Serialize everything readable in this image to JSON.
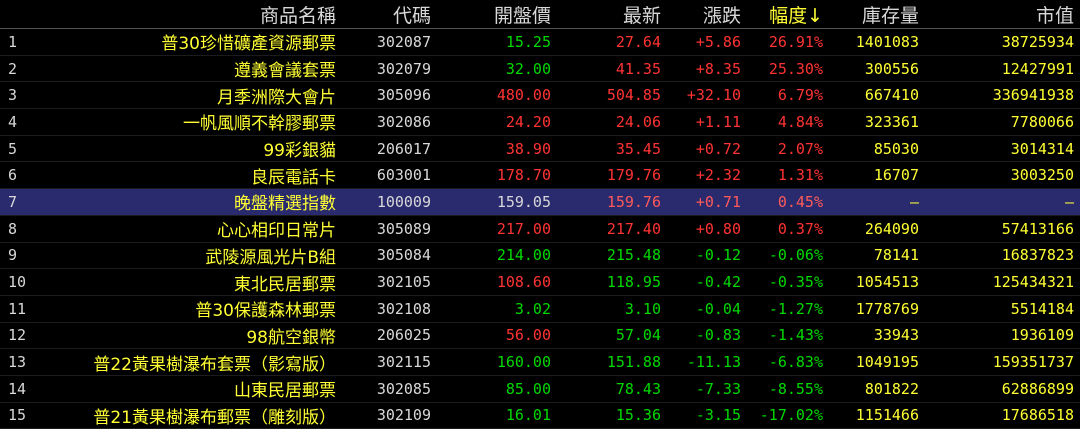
{
  "headers": {
    "name": "商品名稱",
    "code": "代碼",
    "open": "開盤價",
    "latest": "最新",
    "change": "漲跌",
    "pct": "幅度↓",
    "stock": "庫存量",
    "cap": "市值"
  },
  "rows": [
    {
      "idx": "1",
      "name": "普30珍惜礦產資源郵票",
      "code": "302087",
      "open": "15.25",
      "open_color": "green",
      "latest": "27.64",
      "latest_color": "red",
      "change": "+5.86",
      "change_color": "red",
      "pct": "26.91%",
      "pct_color": "red",
      "stock": "1401083",
      "cap": "38725934"
    },
    {
      "idx": "2",
      "name": "遵義會議套票",
      "code": "302079",
      "open": "32.00",
      "open_color": "green",
      "latest": "41.35",
      "latest_color": "red",
      "change": "+8.35",
      "change_color": "red",
      "pct": "25.30%",
      "pct_color": "red",
      "stock": "300556",
      "cap": "12427991"
    },
    {
      "idx": "3",
      "name": "月季洲際大會片",
      "code": "305096",
      "open": "480.00",
      "open_color": "red",
      "latest": "504.85",
      "latest_color": "red",
      "change": "+32.10",
      "change_color": "red",
      "pct": "6.79%",
      "pct_color": "red",
      "stock": "667410",
      "cap": "336941938"
    },
    {
      "idx": "4",
      "name": "一帆風順不幹膠郵票",
      "code": "302086",
      "open": "24.20",
      "open_color": "red",
      "latest": "24.06",
      "latest_color": "red",
      "change": "+1.11",
      "change_color": "red",
      "pct": "4.84%",
      "pct_color": "red",
      "stock": "323361",
      "cap": "7780066"
    },
    {
      "idx": "5",
      "name": "99彩銀貓",
      "code": "206017",
      "open": "38.90",
      "open_color": "red",
      "latest": "35.45",
      "latest_color": "red",
      "change": "+0.72",
      "change_color": "red",
      "pct": "2.07%",
      "pct_color": "red",
      "stock": "85030",
      "cap": "3014314"
    },
    {
      "idx": "6",
      "name": "良辰電話卡",
      "code": "603001",
      "open": "178.70",
      "open_color": "red",
      "latest": "179.76",
      "latest_color": "red",
      "change": "+2.32",
      "change_color": "red",
      "pct": "1.31%",
      "pct_color": "red",
      "stock": "16707",
      "cap": "3003250"
    },
    {
      "idx": "7",
      "name": "晚盤精選指數",
      "code": "100009",
      "open": "159.05",
      "open_color": "plain",
      "latest": "159.76",
      "latest_color": "red",
      "change": "+0.71",
      "change_color": "red",
      "pct": "0.45%",
      "pct_color": "red",
      "stock": "—",
      "cap": "—",
      "selected": true
    },
    {
      "idx": "8",
      "name": "心心相印日常片",
      "code": "305089",
      "open": "217.00",
      "open_color": "red",
      "latest": "217.40",
      "latest_color": "red",
      "change": "+0.80",
      "change_color": "red",
      "pct": "0.37%",
      "pct_color": "red",
      "stock": "264090",
      "cap": "57413166"
    },
    {
      "idx": "9",
      "name": "武陵源風光片B組",
      "code": "305084",
      "open": "214.00",
      "open_color": "green",
      "latest": "215.48",
      "latest_color": "green",
      "change": "-0.12",
      "change_color": "green",
      "pct": "-0.06%",
      "pct_color": "green",
      "stock": "78141",
      "cap": "16837823"
    },
    {
      "idx": "10",
      "name": "東北民居郵票",
      "code": "302105",
      "open": "108.60",
      "open_color": "red",
      "latest": "118.95",
      "latest_color": "green",
      "change": "-0.42",
      "change_color": "green",
      "pct": "-0.35%",
      "pct_color": "green",
      "stock": "1054513",
      "cap": "125434321"
    },
    {
      "idx": "11",
      "name": "普30保護森林郵票",
      "code": "302108",
      "open": "3.02",
      "open_color": "green",
      "latest": "3.10",
      "latest_color": "green",
      "change": "-0.04",
      "change_color": "green",
      "pct": "-1.27%",
      "pct_color": "green",
      "stock": "1778769",
      "cap": "5514184"
    },
    {
      "idx": "12",
      "name": "98航空銀幣",
      "code": "206025",
      "open": "56.00",
      "open_color": "red",
      "latest": "57.04",
      "latest_color": "green",
      "change": "-0.83",
      "change_color": "green",
      "pct": "-1.43%",
      "pct_color": "green",
      "stock": "33943",
      "cap": "1936109"
    },
    {
      "idx": "13",
      "name": "普22黃果樹瀑布套票（影寫版）",
      "code": "302115",
      "open": "160.00",
      "open_color": "green",
      "latest": "151.88",
      "latest_color": "green",
      "change": "-11.13",
      "change_color": "green",
      "pct": "-6.83%",
      "pct_color": "green",
      "stock": "1049195",
      "cap": "159351737"
    },
    {
      "idx": "14",
      "name": "山東民居郵票",
      "code": "302085",
      "open": "85.00",
      "open_color": "green",
      "latest": "78.43",
      "latest_color": "green",
      "change": "-7.33",
      "change_color": "green",
      "pct": "-8.55%",
      "pct_color": "green",
      "stock": "801822",
      "cap": "62886899"
    },
    {
      "idx": "15",
      "name": "普21黃果樹瀑布郵票（雕刻版）",
      "code": "302109",
      "open": "16.01",
      "open_color": "green",
      "latest": "15.36",
      "latest_color": "green",
      "change": "-3.15",
      "change_color": "green",
      "pct": "-17.02%",
      "pct_color": "green",
      "stock": "1151466",
      "cap": "17686518"
    }
  ]
}
